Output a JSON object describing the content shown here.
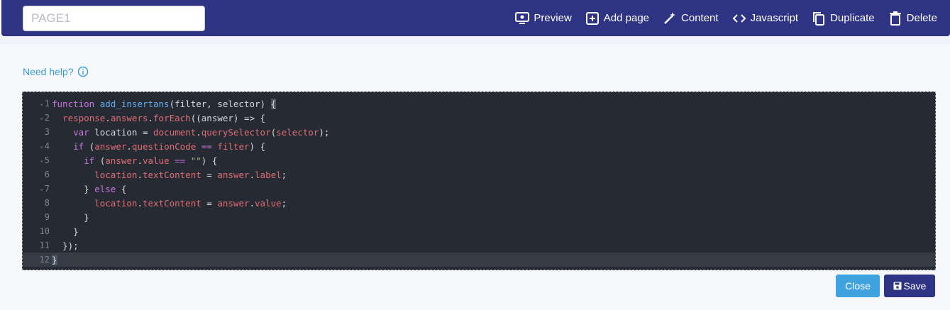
{
  "header": {
    "page_name_value": "",
    "page_name_placeholder": "PAGE1",
    "actions": [
      {
        "label": "Preview",
        "icon": "preview-icon"
      },
      {
        "label": "Add page",
        "icon": "add-page-icon"
      },
      {
        "label": "Content",
        "icon": "magic-wand-icon"
      },
      {
        "label": "Javascript",
        "icon": "code-icon"
      },
      {
        "label": "Duplicate",
        "icon": "duplicate-icon"
      },
      {
        "label": "Delete",
        "icon": "trash-icon"
      }
    ]
  },
  "help": {
    "label": "Need help?",
    "icon": "info-icon"
  },
  "editor": {
    "line_numbers": [
      "1",
      "2",
      "3",
      "4",
      "5",
      "6",
      "7",
      "8",
      "9",
      "10",
      "11",
      "12"
    ],
    "lines": [
      "function add_insertans(filter, selector) {",
      "  response.answers.forEach((answer) => {",
      "    var location = document.querySelector(selector);",
      "    if (answer.questionCode == filter) {",
      "      if (answer.value == \"\") {",
      "        location.textContent = answer.label;",
      "      } else {",
      "        location.textContent = answer.value;",
      "      }",
      "    }",
      "  });",
      "}"
    ]
  },
  "buttons": {
    "close_label": "Close",
    "save_label": "Save"
  },
  "colors": {
    "header": "#2e3483",
    "accent": "#3fa3e0",
    "editor_bg": "#262b33"
  }
}
